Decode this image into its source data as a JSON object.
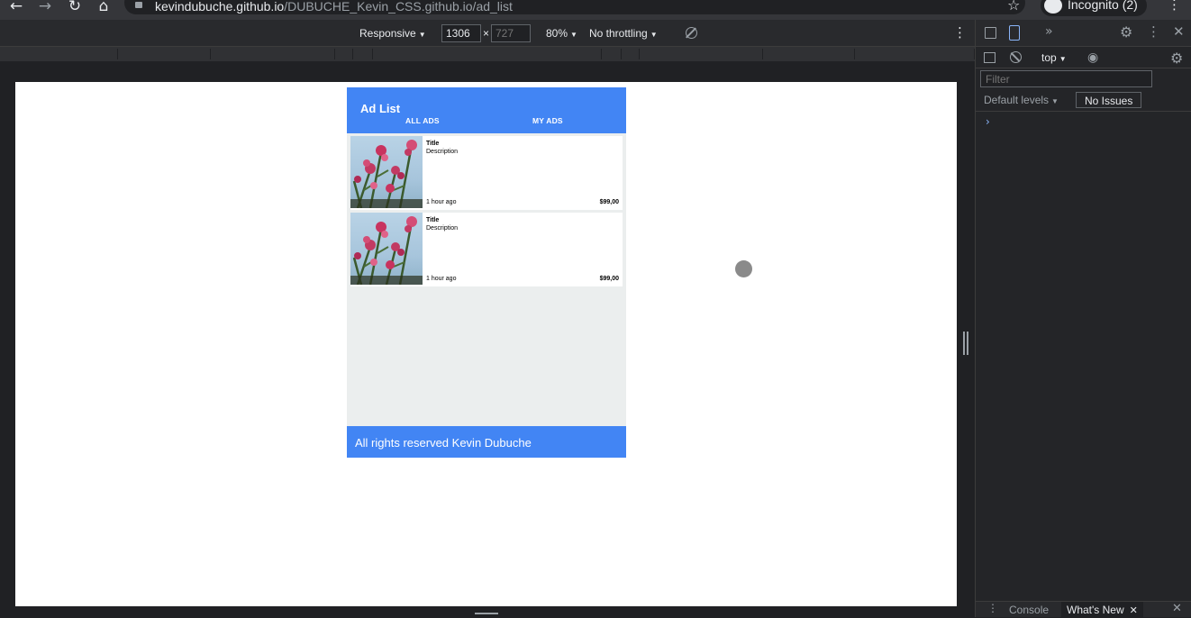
{
  "browser": {
    "url_host": "kevindubuche.github.io",
    "url_path": "/DUBUCHE_Kevin_CSS.github.io/ad_list",
    "incognito_label": "Incognito (2)"
  },
  "device_toolbar": {
    "mode": "Responsive",
    "width": "1306",
    "height_placeholder": "727",
    "times": "×",
    "zoom": "80%",
    "throttling": "No throttling"
  },
  "app": {
    "title": "Ad List",
    "tabs": [
      "ALL ADS",
      "MY ADS"
    ],
    "ads": [
      {
        "title": "Title",
        "description": "Description",
        "time": "1 hour ago",
        "price": "$99,00"
      },
      {
        "title": "Title",
        "description": "Description",
        "time": "1 hour ago",
        "price": "$99,00"
      }
    ],
    "footer": "All rights reserved Kevin Dubuche",
    "colors": {
      "primary": "#4285f4",
      "background": "#ebeeee"
    }
  },
  "devtools": {
    "context": "top",
    "filter_placeholder": "Filter",
    "levels": "Default levels",
    "issues": "No Issues",
    "prompt": "›",
    "drawer_tabs": [
      "Console",
      "What's New"
    ]
  }
}
